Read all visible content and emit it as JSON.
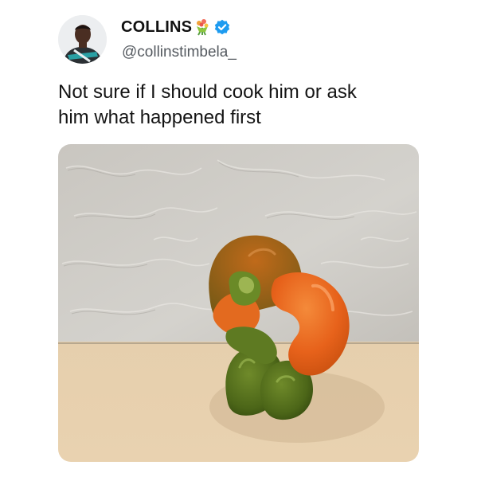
{
  "tweet": {
    "author": {
      "display_name": "COLLINS",
      "name_emoji": "bouquet-icon",
      "verified": true,
      "handle": "@collinstimbela_",
      "avatar": "avatar-photo"
    },
    "text": "Not sure if I should cook him or ask\nhim what happened first",
    "media": {
      "type": "photo",
      "subject": "bell-pepper-photo"
    },
    "colors": {
      "verified_badge": "#1d9bf0",
      "wall": "#cfcdc8",
      "floor": "#e2c9a6",
      "pepper_orange": "#e8661c",
      "pepper_green": "#4f6a1c"
    }
  }
}
